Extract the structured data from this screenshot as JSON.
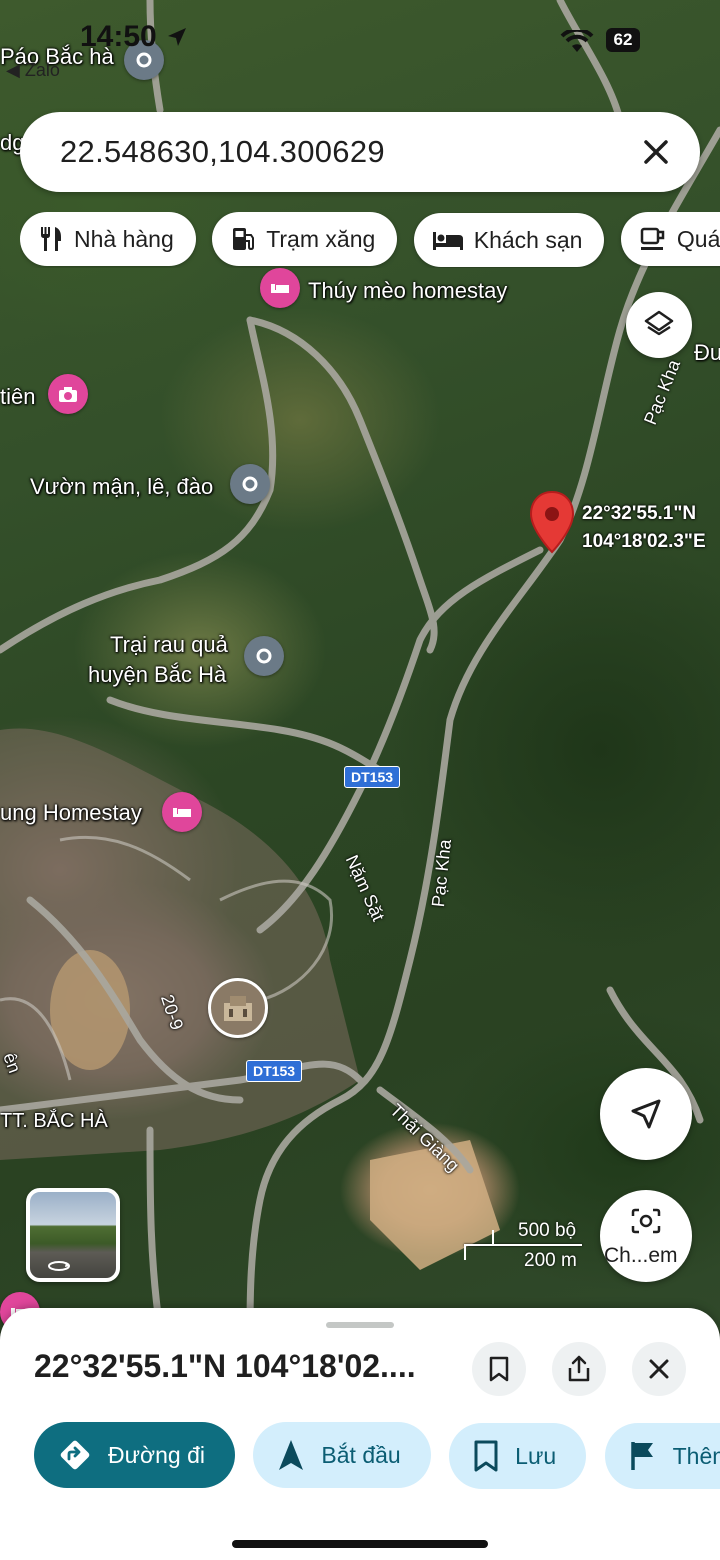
{
  "status_bar": {
    "time": "14:50",
    "battery": "62",
    "back_app": "Zalo"
  },
  "search": {
    "query": "22.548630,104.300629"
  },
  "chips": [
    {
      "label": "Nhà hàng",
      "icon": "fork-knife-icon"
    },
    {
      "label": "Trạm xăng",
      "icon": "gas-station-icon"
    },
    {
      "label": "Khách sạn",
      "icon": "bed-icon"
    },
    {
      "label": "Quán",
      "icon": "cafe-icon"
    }
  ],
  "map": {
    "places": {
      "pao_bac_ha": "Páo Bắc hà",
      "thuy_meo": "Thúy mèo homestay",
      "tien": "tiên",
      "vuon_man": "Vườn mận, lê, đào",
      "trai_rau_1": "Trại rau quả",
      "trai_rau_2": "huyện Bắc Hà",
      "homestay": "ung Homestay",
      "tt_bac_ha": "TT. BẮC HÀ",
      "dg": "dg",
      "en": "ên",
      "du": "Đư"
    },
    "roads": {
      "dt153_a": "DT153",
      "dt153_b": "DT153",
      "pac_kha_1": "Pạc Kha",
      "pac_kha_2": "Pạc Kha",
      "nam_sat": "Nặm Sặt",
      "thai_giang": "Thải Giàng",
      "r20_9": "20-9"
    },
    "pin": {
      "lat": "22°32'55.1\"N",
      "lng": "104°18'02.3\"E"
    },
    "scale": {
      "imperial": "500 bộ",
      "metric": "200 m"
    },
    "camera_label": "Ch...em"
  },
  "sheet": {
    "title": "22°32'55.1\"N 104°18'02....",
    "actions": [
      {
        "label": "Đường đi",
        "icon": "directions-icon"
      },
      {
        "label": "Bắt đầu",
        "icon": "navigation-arrow-icon"
      },
      {
        "label": "Lưu",
        "icon": "bookmark-icon"
      },
      {
        "label": "Thêm",
        "icon": "flag-icon"
      }
    ]
  },
  "colors": {
    "primary_action": "#0e6e80",
    "action_bg": "#d3eefc",
    "pin": "#e53935",
    "poi_pink": "#e0469b",
    "poi_gray": "#6b7a87"
  }
}
